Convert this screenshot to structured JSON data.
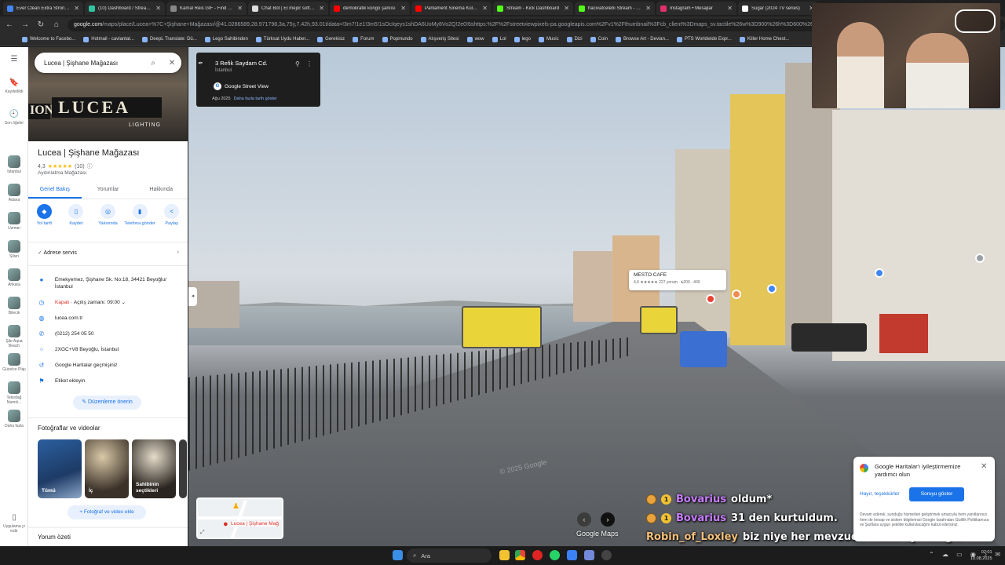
{
  "browser": {
    "tabs": [
      {
        "label": "Ever Clean Extra Strong Kedi",
        "color": "#4285f4"
      },
      {
        "label": "(10) Dashboard / StreamLabs",
        "color": "#31c3a2"
      },
      {
        "label": "Kamal Reis GIF - Find & Share",
        "color": "#888888"
      },
      {
        "label": "Chat Bot | El mejor software",
        "color": "#dddddd"
      },
      {
        "label": "demokratik kongo şarkısı",
        "color": "#ff0000"
      },
      {
        "label": "Parliament Sinema Kulübü",
        "color": "#ff0000"
      },
      {
        "label": "Stream - Kick Dashboard",
        "color": "#53fc18"
      },
      {
        "label": "hacivatcelebi Stream - Web",
        "color": "#53fc18"
      },
      {
        "label": "Instagram • Mesajlar",
        "color": "#e1306c"
      },
      {
        "label": "Sugar (2024 TV series)",
        "color": "#ffffff"
      }
    ],
    "url_host": "google.com",
    "url_path": "/maps/place/Lucea+%7C+Şişhane+Mağazası/@41.0286589,28.971798,3a,75y,7.42h,93.01t/data=!3m7!1e1!3m5!1sOcIqeys1shDA6UoMy8Vo2Q!2e0!6shttps:%2F%2Fstreetviewpixels-pa.googleapis.com%2Fv1%2Fthumbnail%3Fcb_client%3Dmaps_sv.tactile%26w%3D900%26h%3D600%26pitch%",
    "bookmarks": [
      "Welcome to Facebo...",
      "Hotmail - cavlantat...",
      "DeepL Translate: Dü...",
      "Lego Sahibinden",
      "Türksat Uydu Haber...",
      "Gerekisiz",
      "Forum",
      "Popmundo",
      "Alışveriş Sitesi",
      "wow",
      "Lol",
      "lego",
      "Music",
      "Dizi",
      "Coin",
      "Browse Art - Devian...",
      "PTS Worldwide Expr...",
      "Killer Home Chest..."
    ]
  },
  "rail": {
    "saved": "Kaydedildi",
    "recent": "Son öğeler",
    "places": [
      "İstanbul",
      "Adana",
      "Uzman",
      "Silivri",
      "Ankara",
      "Bilecik",
      "Şile Aqua Beach",
      "Güzelce Plajı",
      "Tekirdağ Namık...",
      "Daha fazla"
    ],
    "app": "Uygulama yı indir"
  },
  "panel": {
    "search_value": "Lucea | Şişhane Mağazası",
    "hero_sign": "LUCEA",
    "hero_sub": "LIGHTING",
    "title": "Lucea | Şişhane Mağazası",
    "rating": "4,3",
    "stars": "★★★★★",
    "reviews": "(10)",
    "category": "Aydınlatma Mağazası",
    "tabs": [
      "Genel Bakış",
      "Yorumlar",
      "Hakkında"
    ],
    "actions": [
      "Yol tarifi",
      "Kaydet",
      "Yakınında",
      "Telefona gönder",
      "Paylaş"
    ],
    "service": "Adrese servis",
    "info": {
      "address": "Emekyemez, Şişhane Sk. No:18, 34421 Beyoğlu/İstanbul",
      "status_closed": "Kapalı",
      "status_open": " · Açılış zamanı: 09:00",
      "website": "lucea.com.tr",
      "phone": "(0212) 254 05 50",
      "plus_code": "2XGC+V8 Beyoğlu, İstanbul",
      "history": "Google Haritalar geçmişiniz",
      "label": "Etiket ekleyin"
    },
    "edit_button": "Düzenleme önerin",
    "photos_title": "Fotoğraflar ve videolar",
    "photos": [
      "Tümü",
      "İç",
      "Sahibinin seçtikleri"
    ],
    "add_photo": "Fotoğraf ve video ekle",
    "reviews_title": "Yorum özeti"
  },
  "streetview": {
    "address": "3 Refik Saydam Cd.",
    "city": "İstanbul",
    "gsv": "Google Street View",
    "date": "Ağu 2025",
    "date_link": "Daha fazla tarih göster",
    "place_name": "MESTO CAFE",
    "place_rating": "4,6 ★★★★★ 227 yorum · ₺200 - 400",
    "minimap_label": "Lucea | Şişhane Mağ",
    "watermark": "© 2025 Google",
    "logo": "Google Maps"
  },
  "chat": [
    {
      "user": "Bovarius",
      "msg": "oldum*"
    },
    {
      "user": "Bovarius",
      "msg": "31 den kurtuldum."
    },
    {
      "user": "Robin_of_Loxley",
      "msg": "biz niye her mevzuda hakkı ayıracağız"
    }
  ],
  "feedback": {
    "title": "Google Haritalar'ı iyileştirmemize yardımcı olun",
    "no": "Hayır, teşekkürler",
    "yes": "Soruyu göster",
    "text": "Devam ederek, sunduğu hizmetleri geliştirmek amacıyla hem yanıtlarınızı hem de hesap ve sistem bilgilerinizi Google tarafından Gizlilik Politikamıza ve Şartlara uygun şekilde kullanılacağını kabul edersiniz."
  },
  "taskbar": {
    "search": "Ara",
    "time": "02:01",
    "date": "10.08.2025"
  }
}
